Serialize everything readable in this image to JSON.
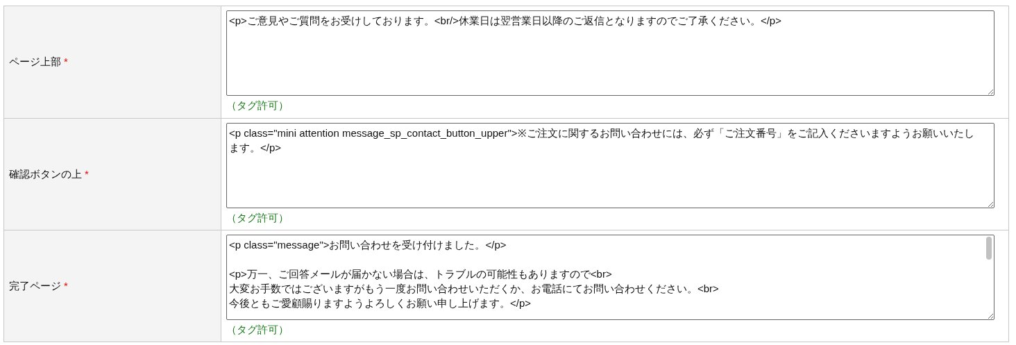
{
  "rows": [
    {
      "label": "ページ上部",
      "required_mark": "*",
      "value": "<p>ご意見やご質問をお受けしております。<br/>休業日は翌営業日以降のご返信となりますのでご了承ください。</p>",
      "hint": "（タグ許可）",
      "scrollable": false
    },
    {
      "label": "確認ボタンの上",
      "required_mark": "*",
      "value": "<p class=\"mini attention message_sp_contact_button_upper\">※ご注文に関するお問い合わせには、必ず「ご注文番号」をご記入くださいますようお願いいたします。</p>",
      "hint": "（タグ許可）",
      "scrollable": false
    },
    {
      "label": "完了ページ",
      "required_mark": "*",
      "value": "<p class=\"message\">お問い合わせを受け付けました。</p>\n\n<p>万一、ご回答メールが届かない場合は、トラブルの可能性もありますので<br>\n大変お手数ではございますがもう一度お問い合わせいただくか、お電話にてお問い合わせください。<br>\n今後ともご愛顧賜りますようよろしくお願い申し上げます。</p>",
      "hint": "（タグ許可）",
      "scrollable": true
    }
  ]
}
